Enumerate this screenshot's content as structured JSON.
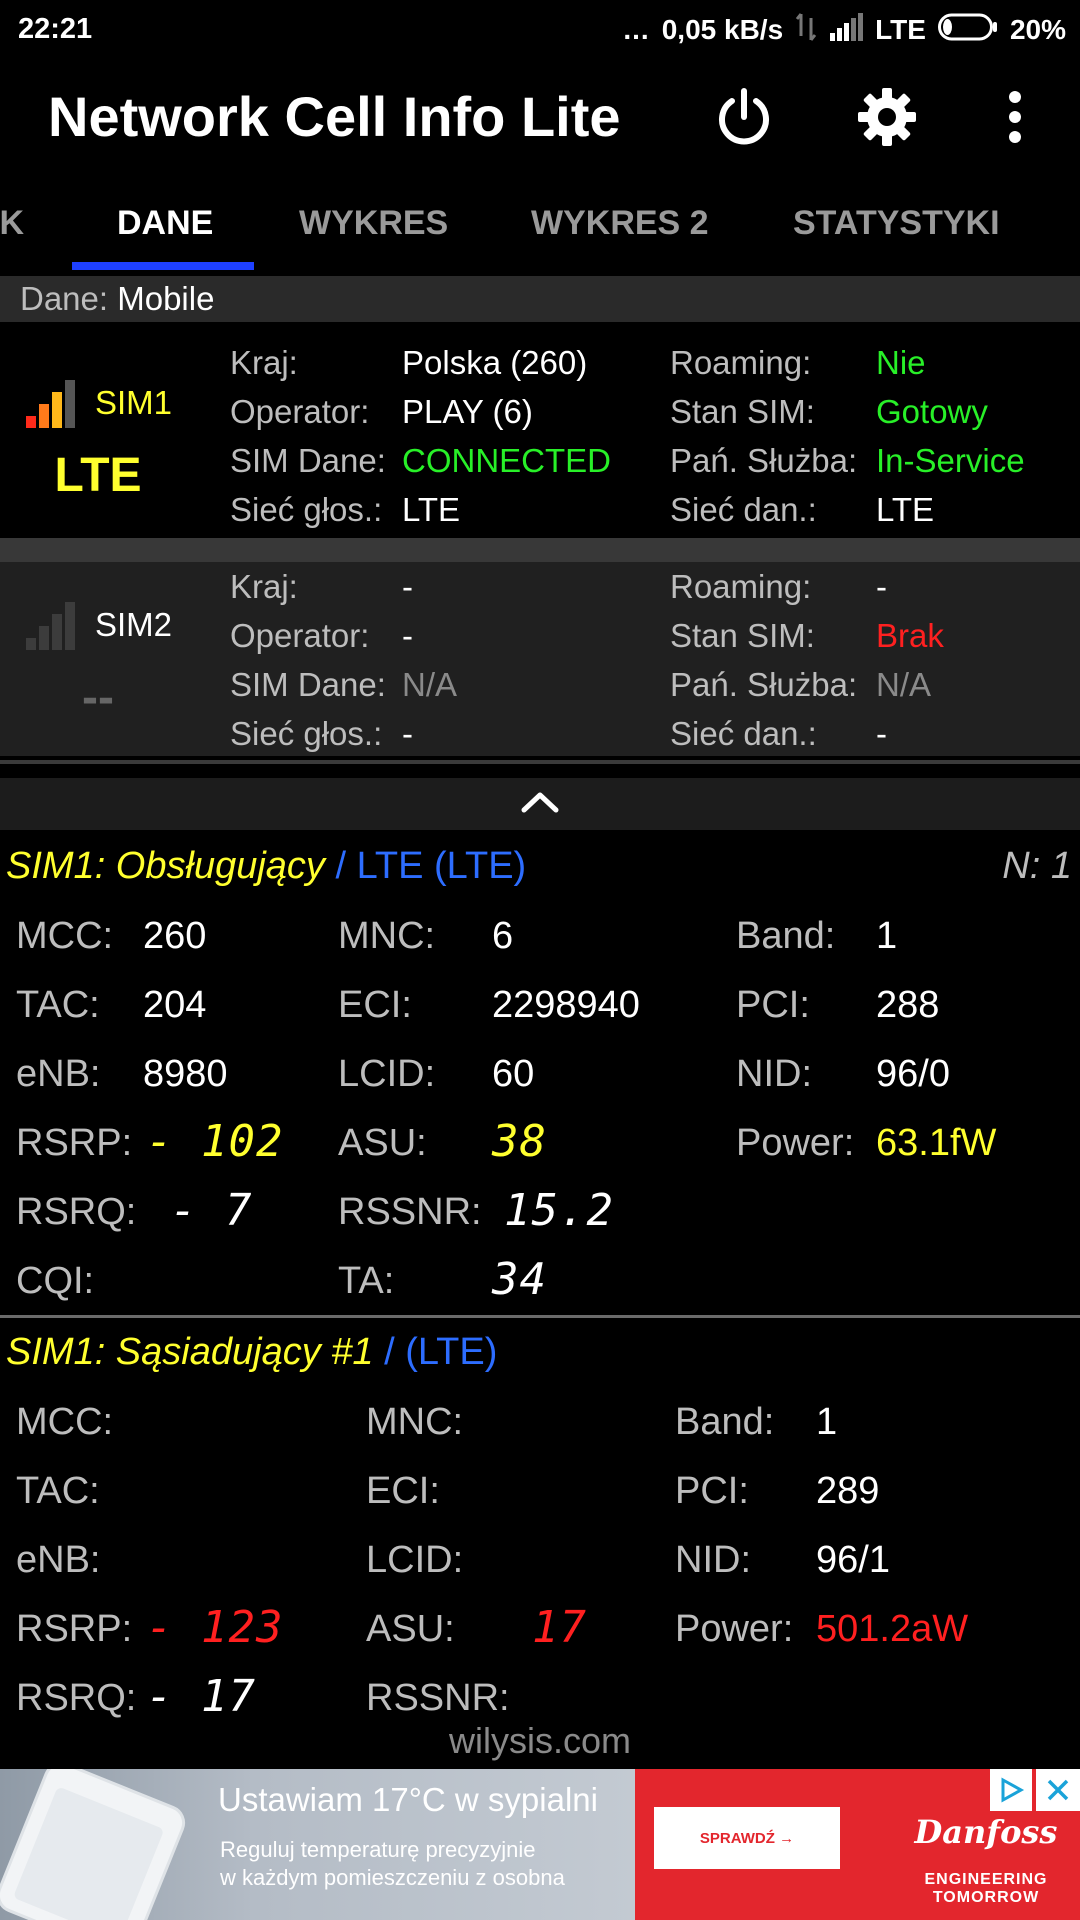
{
  "status_bar": {
    "time": "22:21",
    "dots": "...",
    "speed": "0,05 kB/s",
    "network": "LTE",
    "battery": "20%",
    "battery_level": 0.2
  },
  "app_bar": {
    "title": "Network Cell Info Lite",
    "icons": [
      "power-icon",
      "gear-icon",
      "more-vert-icon"
    ]
  },
  "tabs": [
    {
      "label": "IK",
      "active": false
    },
    {
      "label": "DANE",
      "active": true
    },
    {
      "label": "WYKRES",
      "active": false
    },
    {
      "label": "WYKRES 2",
      "active": false
    },
    {
      "label": "STATYSTYKI",
      "active": false
    }
  ],
  "dane": {
    "label": "Dane:",
    "value": "Mobile"
  },
  "sim1": {
    "name": "SIM1",
    "tech": "LTE",
    "signal_bars": 3,
    "left": [
      {
        "k": "Kraj:",
        "v": "Polska (260)"
      },
      {
        "k": "Operator:",
        "v": "PLAY (6)"
      },
      {
        "k": "SIM Dane:",
        "v": "CONNECTED"
      },
      {
        "k": "Sieć głos.:",
        "v": "LTE"
      }
    ],
    "right": [
      {
        "k": "Roaming:",
        "v": "Nie"
      },
      {
        "k": "Stan SIM:",
        "v": "Gotowy"
      },
      {
        "k": "Pań. Służba:",
        "v": "In-Service"
      },
      {
        "k": "Sieć dan.:",
        "v": "LTE"
      }
    ]
  },
  "sim2": {
    "name": "SIM2",
    "tech": "--",
    "signal_bars": 0,
    "left": [
      {
        "k": "Kraj:",
        "v": "-"
      },
      {
        "k": "Operator:",
        "v": "-"
      },
      {
        "k": "SIM Dane:",
        "v": "N/A"
      },
      {
        "k": "Sieć głos.:",
        "v": "-"
      }
    ],
    "right": [
      {
        "k": "Roaming:",
        "v": "-"
      },
      {
        "k": "Stan SIM:",
        "v": "Brak"
      },
      {
        "k": "Pań. Służba:",
        "v": "N/A"
      },
      {
        "k": "Sieć dan.:",
        "v": "-"
      }
    ]
  },
  "serving": {
    "title": "SIM1: Obsługujący",
    "tech": "/ LTE (LTE)",
    "n": "N: 1",
    "mcc_l": "MCC:",
    "mcc": "260",
    "mnc_l": "MNC:",
    "mnc": "6",
    "band_l": "Band:",
    "band": "1",
    "tac_l": "TAC:",
    "tac": "204",
    "eci_l": "ECI:",
    "eci": "2298940",
    "pci_l": "PCI:",
    "pci": "288",
    "enb_l": "eNB:",
    "enb": "8980",
    "lcid_l": "LCID:",
    "lcid": "60",
    "nid_l": "NID:",
    "nid": "96/0",
    "rsrp_l": "RSRP:",
    "rsrp": "- 102",
    "asu_l": "ASU:",
    "asu": "38",
    "power_l": "Power:",
    "power": "63.1fW",
    "rsrq_l": "RSRQ:",
    "rsrq": "- 7",
    "rssnr_l": "RSSNR:",
    "rssnr": "15.2",
    "cqi_l": "CQI:",
    "ta_l": "TA:",
    "ta": "34"
  },
  "neighbor": {
    "title": "SIM1: Sąsiadujący #1",
    "tech": "/ (LTE)",
    "mcc_l": "MCC:",
    "mnc_l": "MNC:",
    "band_l": "Band:",
    "band": "1",
    "tac_l": "TAC:",
    "eci_l": "ECI:",
    "pci_l": "PCI:",
    "pci": "289",
    "enb_l": "eNB:",
    "lcid_l": "LCID:",
    "nid_l": "NID:",
    "nid": "96/1",
    "rsrp_l": "RSRP:",
    "rsrp": "- 123",
    "asu_l": "ASU:",
    "asu": "17",
    "power_l": "Power:",
    "power": "501.2aW",
    "rsrq_l": "RSRQ:",
    "rsrq": "- 17",
    "rssnr_l": "RSSNR:"
  },
  "watermark": "wilysis.com",
  "ad": {
    "headline": "Ustawiam 17°C w sypialni",
    "line1": "Reguluj temperaturę precyzyjnie",
    "line2": "w każdym pomieszczeniu z osobna",
    "cta": "SPRAWDŹ →",
    "brand": "Danfoss",
    "tagline1": "ENGINEERING",
    "tagline2": "TOMORROW"
  },
  "colors": {
    "tab_indicator": "#1e40ff",
    "green": "#28f028",
    "yellow": "#ffff2e",
    "red": "#ff2020",
    "blue": "#2d6dff"
  }
}
